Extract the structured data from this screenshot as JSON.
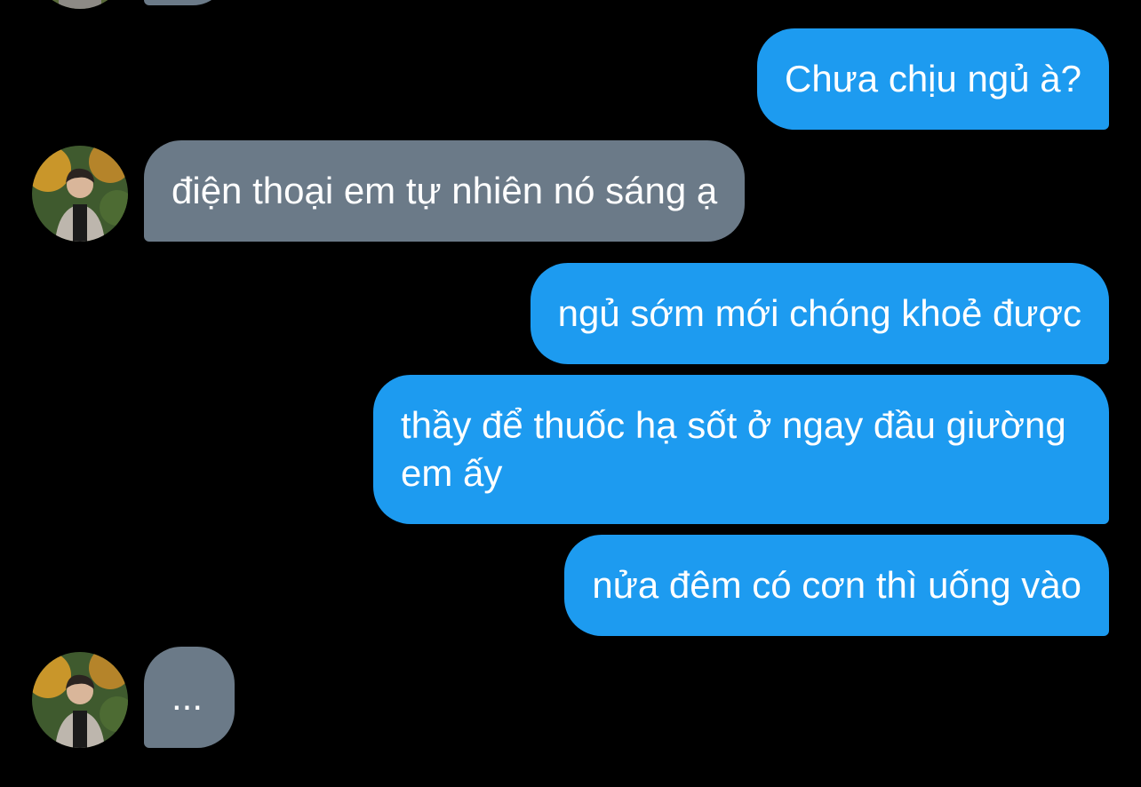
{
  "conversation": {
    "messages": [
      {
        "side": "outgoing",
        "text": "Chưa chịu ngủ à?"
      },
      {
        "side": "incoming",
        "text": "điện thoại em tự nhiên nó sáng ạ"
      },
      {
        "side": "outgoing",
        "text": "ngủ sớm mới chóng khoẻ được"
      },
      {
        "side": "outgoing",
        "text": "thầy để thuốc hạ sốt ở ngay đầu giường em ấy"
      },
      {
        "side": "outgoing",
        "text": "nửa đêm có cơn thì uống vào"
      },
      {
        "side": "incoming",
        "text": "..."
      }
    ]
  },
  "colors": {
    "background": "#000000",
    "outgoing_bubble": "#1d9bf0",
    "incoming_bubble": "#6b7a88",
    "text": "#ffffff"
  }
}
